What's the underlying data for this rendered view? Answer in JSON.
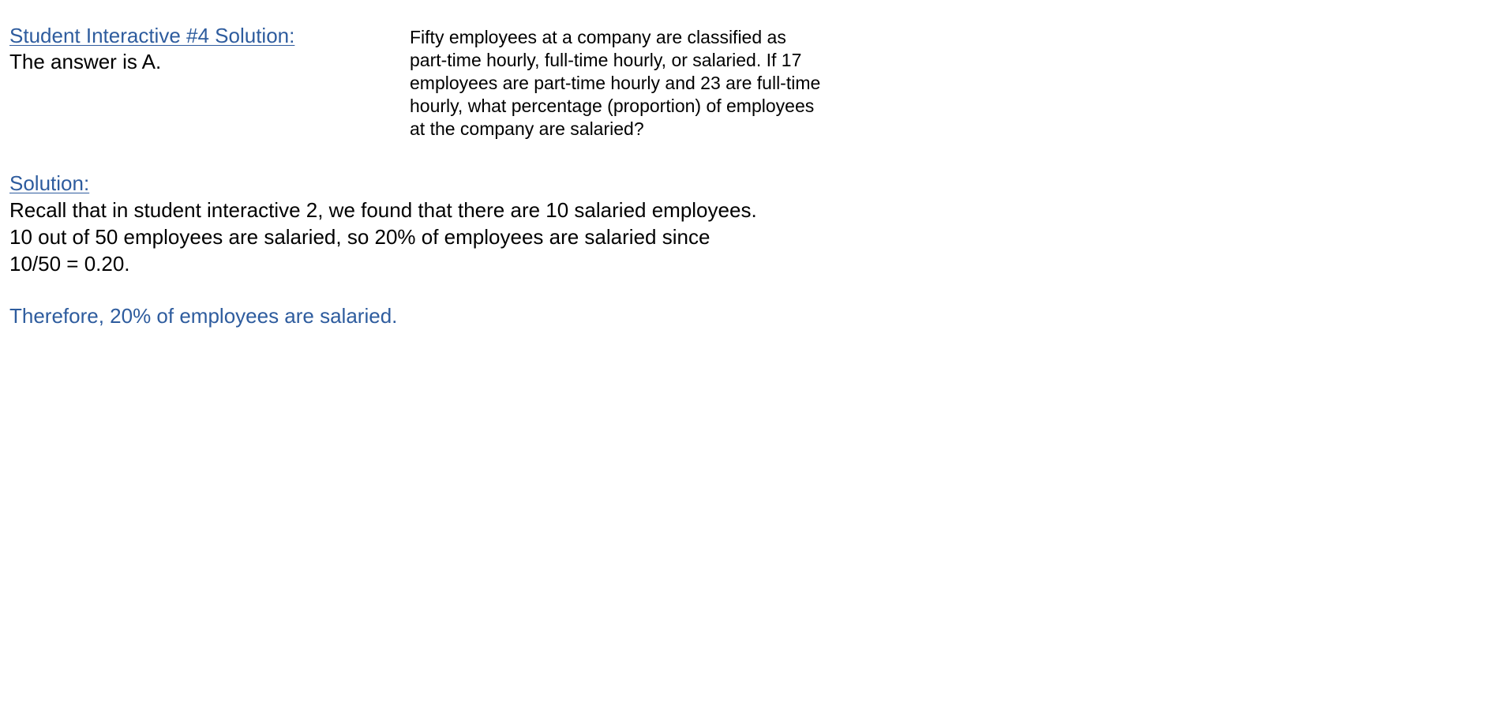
{
  "header": {
    "title": "Student Interactive #4 Solution:",
    "answer": "The answer is A."
  },
  "question": {
    "lines": [
      "Fifty employees at a company are classified as",
      "part-time hourly, full-time hourly, or salaried. If 17",
      "employees are part-time hourly and 23 are full-time",
      "hourly, what percentage (proportion) of employees",
      "at the company are salaried?"
    ]
  },
  "solution": {
    "heading": "Solution:",
    "lines": [
      "Recall that in student interactive 2, we found that there are 10 salaried employees.",
      "10 out of 50 employees are salaried, so 20% of employees are salaried since",
      "10/50 = 0.20."
    ],
    "conclusion": "Therefore, 20% of employees are salaried."
  },
  "colors": {
    "accent": "#2e5c9e",
    "text": "#000000",
    "background": "#ffffff"
  }
}
